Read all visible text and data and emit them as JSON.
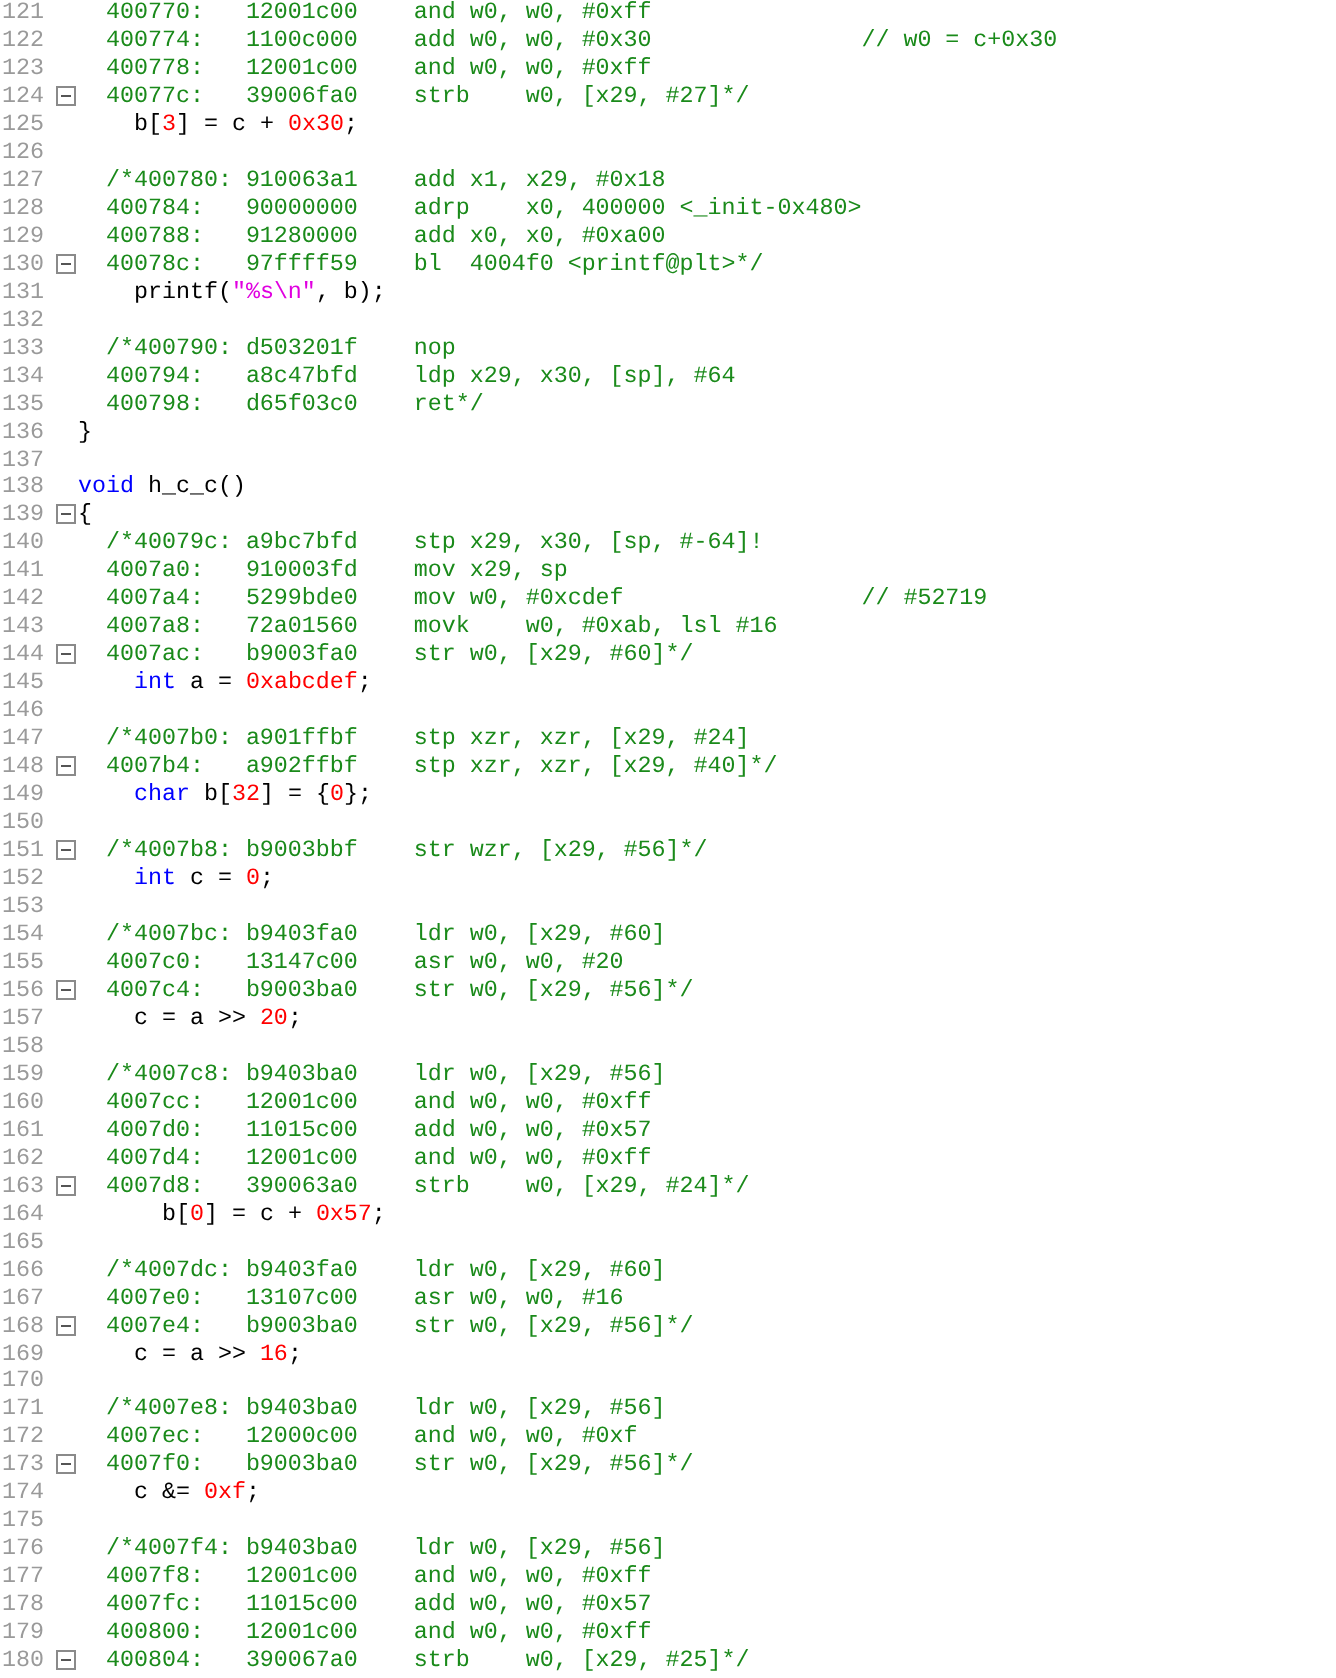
{
  "editor": {
    "lines": [
      {
        "number": "121",
        "segments": [
          {
            "kind": "comment",
            "text": "  400770:   12001c00    and w0, w0, #0xff"
          }
        ]
      },
      {
        "number": "122",
        "segments": [
          {
            "kind": "comment",
            "text": "  400774:   1100c000    add w0, w0, #0x30               // w0 = c+0x30"
          }
        ]
      },
      {
        "number": "123",
        "segments": [
          {
            "kind": "comment",
            "text": "  400778:   12001c00    and w0, w0, #0xff"
          }
        ]
      },
      {
        "number": "124",
        "fold": {
          "expanded": true
        },
        "segments": [
          {
            "kind": "comment",
            "text": "  40077c:   39006fa0    strb    w0, [x29, #27]*/"
          }
        ]
      },
      {
        "number": "125",
        "segments": [
          {
            "kind": "plain",
            "text": "    b["
          },
          {
            "kind": "number",
            "text": "3"
          },
          {
            "kind": "plain",
            "text": "] = c + "
          },
          {
            "kind": "number",
            "text": "0x30"
          },
          {
            "kind": "plain",
            "text": ";"
          }
        ]
      },
      {
        "number": "126"
      },
      {
        "number": "127",
        "segments": [
          {
            "kind": "comment",
            "text": "  /*400780: 910063a1    add x1, x29, #0x18"
          }
        ]
      },
      {
        "number": "128",
        "segments": [
          {
            "kind": "comment",
            "text": "  400784:   90000000    adrp    x0, 400000 <_init-0x480>"
          }
        ]
      },
      {
        "number": "129",
        "segments": [
          {
            "kind": "comment",
            "text": "  400788:   91280000    add x0, x0, #0xa00"
          }
        ]
      },
      {
        "number": "130",
        "fold": {
          "expanded": true
        },
        "segments": [
          {
            "kind": "comment",
            "text": "  40078c:   97ffff59    bl  4004f0 <printf@plt>*/"
          }
        ]
      },
      {
        "number": "131",
        "segments": [
          {
            "kind": "plain",
            "text": "    printf("
          },
          {
            "kind": "string",
            "text": "\"%s\\n\""
          },
          {
            "kind": "plain",
            "text": ", b);"
          }
        ]
      },
      {
        "number": "132"
      },
      {
        "number": "133",
        "segments": [
          {
            "kind": "comment",
            "text": "  /*400790: d503201f    nop"
          }
        ]
      },
      {
        "number": "134",
        "segments": [
          {
            "kind": "comment",
            "text": "  400794:   a8c47bfd    ldp x29, x30, [sp], #64"
          }
        ]
      },
      {
        "number": "135",
        "segments": [
          {
            "kind": "comment",
            "text": "  400798:   d65f03c0    ret*/"
          }
        ]
      },
      {
        "number": "136",
        "segments": [
          {
            "kind": "plain",
            "text": "}"
          }
        ]
      },
      {
        "number": "137"
      },
      {
        "number": "138",
        "segments": [
          {
            "kind": "keyword",
            "text": "void"
          },
          {
            "kind": "plain",
            "text": " h_c_c()"
          }
        ]
      },
      {
        "number": "139",
        "fold": {
          "expanded": true
        },
        "segments": [
          {
            "kind": "plain",
            "text": "{"
          }
        ]
      },
      {
        "number": "140",
        "segments": [
          {
            "kind": "comment",
            "text": "  /*40079c: a9bc7bfd    stp x29, x30, [sp, #-64]!"
          }
        ]
      },
      {
        "number": "141",
        "segments": [
          {
            "kind": "comment",
            "text": "  4007a0:   910003fd    mov x29, sp"
          }
        ]
      },
      {
        "number": "142",
        "segments": [
          {
            "kind": "comment",
            "text": "  4007a4:   5299bde0    mov w0, #0xcdef                 // #52719"
          }
        ]
      },
      {
        "number": "143",
        "segments": [
          {
            "kind": "comment",
            "text": "  4007a8:   72a01560    movk    w0, #0xab, lsl #16"
          }
        ]
      },
      {
        "number": "144",
        "fold": {
          "expanded": true
        },
        "segments": [
          {
            "kind": "comment",
            "text": "  4007ac:   b9003fa0    str w0, [x29, #60]*/"
          }
        ]
      },
      {
        "number": "145",
        "segments": [
          {
            "kind": "keyword",
            "text": "    int"
          },
          {
            "kind": "plain",
            "text": " a = "
          },
          {
            "kind": "number",
            "text": "0xabcdef"
          },
          {
            "kind": "plain",
            "text": ";"
          }
        ]
      },
      {
        "number": "146"
      },
      {
        "number": "147",
        "segments": [
          {
            "kind": "comment",
            "text": "  /*4007b0: a901ffbf    stp xzr, xzr, [x29, #24]"
          }
        ]
      },
      {
        "number": "148",
        "fold": {
          "expanded": true
        },
        "segments": [
          {
            "kind": "comment",
            "text": "  4007b4:   a902ffbf    stp xzr, xzr, [x29, #40]*/"
          }
        ]
      },
      {
        "number": "149",
        "segments": [
          {
            "kind": "keyword",
            "text": "    char"
          },
          {
            "kind": "plain",
            "text": " b["
          },
          {
            "kind": "number",
            "text": "32"
          },
          {
            "kind": "plain",
            "text": "] = {"
          },
          {
            "kind": "number",
            "text": "0"
          },
          {
            "kind": "plain",
            "text": "};"
          }
        ]
      },
      {
        "number": "150"
      },
      {
        "number": "151",
        "fold": {
          "expanded": true
        },
        "segments": [
          {
            "kind": "comment",
            "text": "  /*4007b8: b9003bbf    str wzr, [x29, #56]*/"
          }
        ]
      },
      {
        "number": "152",
        "segments": [
          {
            "kind": "keyword",
            "text": "    int"
          },
          {
            "kind": "plain",
            "text": " c = "
          },
          {
            "kind": "number",
            "text": "0"
          },
          {
            "kind": "plain",
            "text": ";"
          }
        ]
      },
      {
        "number": "153"
      },
      {
        "number": "154",
        "segments": [
          {
            "kind": "comment",
            "text": "  /*4007bc: b9403fa0    ldr w0, [x29, #60]"
          }
        ]
      },
      {
        "number": "155",
        "segments": [
          {
            "kind": "comment",
            "text": "  4007c0:   13147c00    asr w0, w0, #20"
          }
        ]
      },
      {
        "number": "156",
        "fold": {
          "expanded": true
        },
        "segments": [
          {
            "kind": "comment",
            "text": "  4007c4:   b9003ba0    str w0, [x29, #56]*/"
          }
        ]
      },
      {
        "number": "157",
        "segments": [
          {
            "kind": "plain",
            "text": "    c = a >> "
          },
          {
            "kind": "number",
            "text": "20"
          },
          {
            "kind": "plain",
            "text": ";"
          }
        ]
      },
      {
        "number": "158"
      },
      {
        "number": "159",
        "segments": [
          {
            "kind": "comment",
            "text": "  /*4007c8: b9403ba0    ldr w0, [x29, #56]"
          }
        ]
      },
      {
        "number": "160",
        "segments": [
          {
            "kind": "comment",
            "text": "  4007cc:   12001c00    and w0, w0, #0xff"
          }
        ]
      },
      {
        "number": "161",
        "segments": [
          {
            "kind": "comment",
            "text": "  4007d0:   11015c00    add w0, w0, #0x57"
          }
        ]
      },
      {
        "number": "162",
        "segments": [
          {
            "kind": "comment",
            "text": "  4007d4:   12001c00    and w0, w0, #0xff"
          }
        ]
      },
      {
        "number": "163",
        "fold": {
          "expanded": true
        },
        "segments": [
          {
            "kind": "comment",
            "text": "  4007d8:   390063a0    strb    w0, [x29, #24]*/"
          }
        ]
      },
      {
        "number": "164",
        "segments": [
          {
            "kind": "plain",
            "text": "      b["
          },
          {
            "kind": "number",
            "text": "0"
          },
          {
            "kind": "plain",
            "text": "] = c + "
          },
          {
            "kind": "number",
            "text": "0x57"
          },
          {
            "kind": "plain",
            "text": ";"
          }
        ]
      },
      {
        "number": "165"
      },
      {
        "number": "166",
        "segments": [
          {
            "kind": "comment",
            "text": "  /*4007dc: b9403fa0    ldr w0, [x29, #60]"
          }
        ]
      },
      {
        "number": "167",
        "segments": [
          {
            "kind": "comment",
            "text": "  4007e0:   13107c00    asr w0, w0, #16"
          }
        ]
      },
      {
        "number": "168",
        "fold": {
          "expanded": true
        },
        "segments": [
          {
            "kind": "comment",
            "text": "  4007e4:   b9003ba0    str w0, [x29, #56]*/"
          }
        ]
      },
      {
        "number": "169",
        "segments": [
          {
            "kind": "plain",
            "text": "    c = a >> "
          },
          {
            "kind": "number",
            "text": "16"
          },
          {
            "kind": "plain",
            "text": ";"
          }
        ]
      },
      {
        "number": "170"
      },
      {
        "number": "171",
        "segments": [
          {
            "kind": "comment",
            "text": "  /*4007e8: b9403ba0    ldr w0, [x29, #56]"
          }
        ]
      },
      {
        "number": "172",
        "segments": [
          {
            "kind": "comment",
            "text": "  4007ec:   12000c00    and w0, w0, #0xf"
          }
        ]
      },
      {
        "number": "173",
        "fold": {
          "expanded": true
        },
        "segments": [
          {
            "kind": "comment",
            "text": "  4007f0:   b9003ba0    str w0, [x29, #56]*/"
          }
        ]
      },
      {
        "number": "174",
        "segments": [
          {
            "kind": "plain",
            "text": "    c &= "
          },
          {
            "kind": "number",
            "text": "0xf"
          },
          {
            "kind": "plain",
            "text": ";"
          }
        ]
      },
      {
        "number": "175"
      },
      {
        "number": "176",
        "segments": [
          {
            "kind": "comment",
            "text": "  /*4007f4: b9403ba0    ldr w0, [x29, #56]"
          }
        ]
      },
      {
        "number": "177",
        "segments": [
          {
            "kind": "comment",
            "text": "  4007f8:   12001c00    and w0, w0, #0xff"
          }
        ]
      },
      {
        "number": "178",
        "segments": [
          {
            "kind": "comment",
            "text": "  4007fc:   11015c00    add w0, w0, #0x57"
          }
        ]
      },
      {
        "number": "179",
        "segments": [
          {
            "kind": "comment",
            "text": "  400800:   12001c00    and w0, w0, #0xff"
          }
        ]
      },
      {
        "number": "180",
        "fold": {
          "expanded": true
        },
        "segments": [
          {
            "kind": "comment",
            "text": "  400804:   390067a0    strb    w0, [x29, #25]*/"
          }
        ]
      }
    ]
  }
}
